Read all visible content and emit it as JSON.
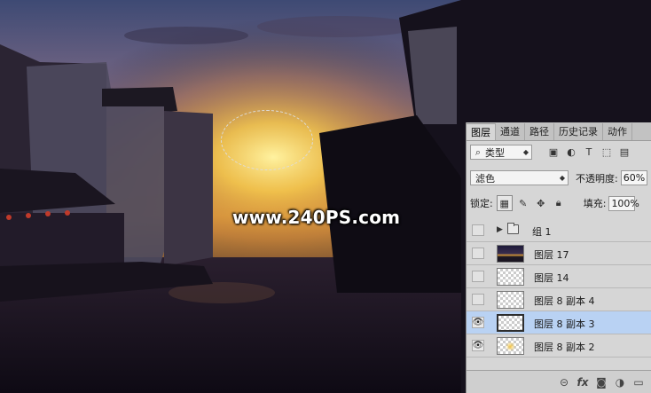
{
  "watermark": "www.240PS.com",
  "panel": {
    "tabs": [
      "图层",
      "通道",
      "路径",
      "历史记录",
      "动作"
    ],
    "active_tab": "图层",
    "filter": {
      "label": "类型",
      "icon": "search-icon"
    },
    "blend_mode": "滤色",
    "opacity": {
      "label": "不透明度:",
      "value": "60%"
    },
    "lock": {
      "label": "锁定:"
    },
    "fill": {
      "label": "填充:",
      "value": "100%"
    },
    "layers": [
      {
        "name": "组 1",
        "visible": false,
        "type": "group"
      },
      {
        "name": "图层 17",
        "visible": false,
        "type": "photo"
      },
      {
        "name": "图层 14",
        "visible": false,
        "type": "transparent"
      },
      {
        "name": "图层 8 副本 4",
        "visible": false,
        "type": "transparent"
      },
      {
        "name": "图层 8 副本 3",
        "visible": true,
        "type": "transparent",
        "selected": true
      },
      {
        "name": "图层 8 副本 2",
        "visible": true,
        "type": "glow"
      }
    ],
    "footer_icons": [
      "link-icon",
      "fx-icon",
      "mask-icon",
      "adjustment-icon",
      "folder-icon"
    ]
  },
  "colors": {
    "selected_row": "#b9d2f3",
    "panel_bg": "#d6d6d6",
    "sun": "#f5c84a"
  }
}
